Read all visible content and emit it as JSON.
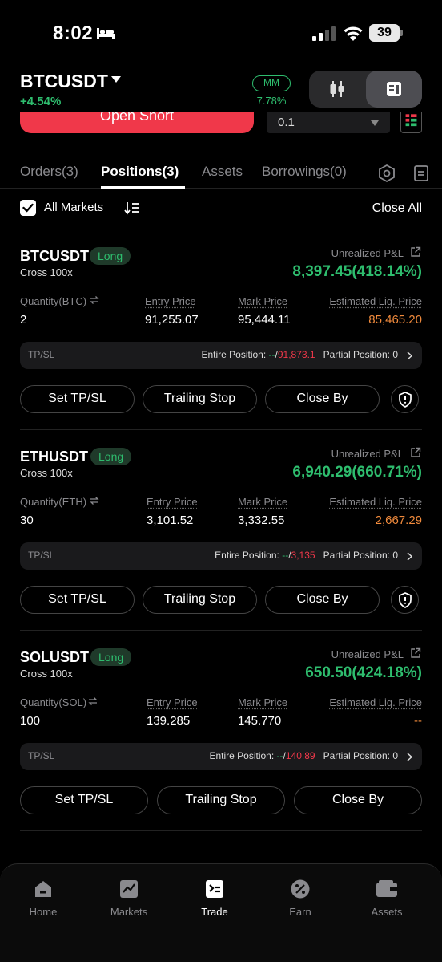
{
  "status_bar": {
    "time": "8:02",
    "battery": "39"
  },
  "header": {
    "symbol": "BTCUSDT",
    "change": "+4.54%",
    "mm_label": "MM",
    "mm_value": "7.78%"
  },
  "order_panel": {
    "open_short_label": "Open Short",
    "quantity_value": "0.1"
  },
  "tabs": [
    {
      "label": "Orders(3)"
    },
    {
      "label": "Positions(3)"
    },
    {
      "label": "Assets"
    },
    {
      "label": "Borrowings(0)"
    }
  ],
  "filter": {
    "all_markets_label": "All Markets",
    "close_all_label": "Close All"
  },
  "labels": {
    "unrealized_pnl": "Unrealized P&L",
    "entry_price": "Entry Price",
    "mark_price": "Mark Price",
    "est_liq_price": "Estimated Liq. Price",
    "tpsl": "TP/SL",
    "entire_position": "Entire Position: ",
    "partial_position": "Partial Position: ",
    "set_tpsl": "Set TP/SL",
    "trailing_stop": "Trailing Stop",
    "close_by": "Close By"
  },
  "positions": [
    {
      "symbol": "BTCUSDT",
      "side": "Long",
      "margin_mode": "Cross 100x",
      "unrealized_pnl": "8,397.45(418.14%)",
      "quantity_label": "Quantity(BTC)",
      "quantity": "2",
      "entry_price": "91,255.07",
      "mark_price": "95,444.11",
      "liq_price": "85,465.20",
      "tp": "--",
      "sl": "91,873.1",
      "partial_count": "0"
    },
    {
      "symbol": "ETHUSDT",
      "side": "Long",
      "margin_mode": "Cross 100x",
      "unrealized_pnl": "6,940.29(660.71%)",
      "quantity_label": "Quantity(ETH)",
      "quantity": "30",
      "entry_price": "3,101.52",
      "mark_price": "3,332.55",
      "liq_price": "2,667.29",
      "tp": "--",
      "sl": "3,135",
      "partial_count": "0"
    },
    {
      "symbol": "SOLUSDT",
      "side": "Long",
      "margin_mode": "Cross 100x",
      "unrealized_pnl": "650.50(424.18%)",
      "quantity_label": "Quantity(SOL)",
      "quantity": "100",
      "entry_price": "139.285",
      "mark_price": "145.770",
      "liq_price": "--",
      "tp": "--",
      "sl": "140.89",
      "partial_count": "0"
    }
  ],
  "bottom_nav": [
    {
      "label": "Home",
      "icon": "home-icon"
    },
    {
      "label": "Markets",
      "icon": "markets-icon"
    },
    {
      "label": "Trade",
      "icon": "trade-icon"
    },
    {
      "label": "Earn",
      "icon": "earn-icon"
    },
    {
      "label": "Assets",
      "icon": "wallet-icon"
    }
  ],
  "colors": {
    "positive": "#2ebd6e",
    "negative": "#f0384a",
    "liquidation": "#f08a3c"
  }
}
